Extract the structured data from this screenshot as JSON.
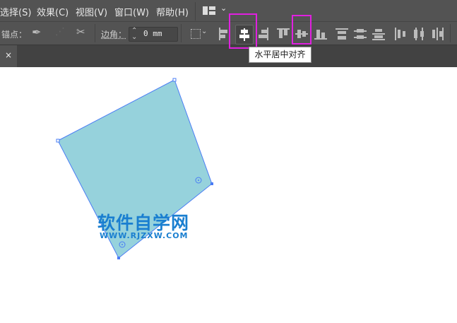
{
  "menu": [
    "选择(S)",
    "效果(C)",
    "视图(V)",
    "窗口(W)",
    "帮助(H)"
  ],
  "toolbar": {
    "anchor_label": "锚点：",
    "corner_label": "边角：",
    "corner_value": "0 mm"
  },
  "tooltip": "水平居中对齐",
  "tab_close": "×",
  "watermark": {
    "title": "软件自学网",
    "url": "WWW.RJZXW.COM"
  },
  "colors": {
    "shape_fill": "#96d2dc",
    "selection": "#4a7cf5",
    "highlight": "#e020e0",
    "watermark": "#1a7fd0"
  }
}
